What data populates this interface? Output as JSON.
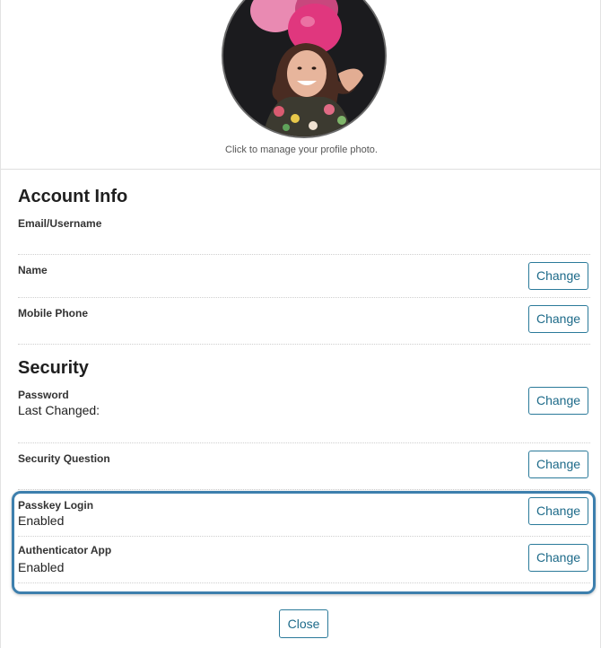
{
  "profile": {
    "caption": "Click to manage your profile photo."
  },
  "account_info": {
    "title": "Account Info",
    "email_label": "Email/Username",
    "name_label": "Name",
    "phone_label": "Mobile Phone"
  },
  "security": {
    "title": "Security",
    "password_label": "Password",
    "password_value": "Last Changed:",
    "security_question_label": "Security Question",
    "passkey_label": "Passkey Login",
    "passkey_value": "Enabled",
    "authenticator_label": "Authenticator App",
    "authenticator_value": "Enabled"
  },
  "buttons": {
    "change": "Change",
    "close": "Close"
  },
  "colors": {
    "accent": "#1d6a89",
    "highlight": "#3d7fad"
  }
}
